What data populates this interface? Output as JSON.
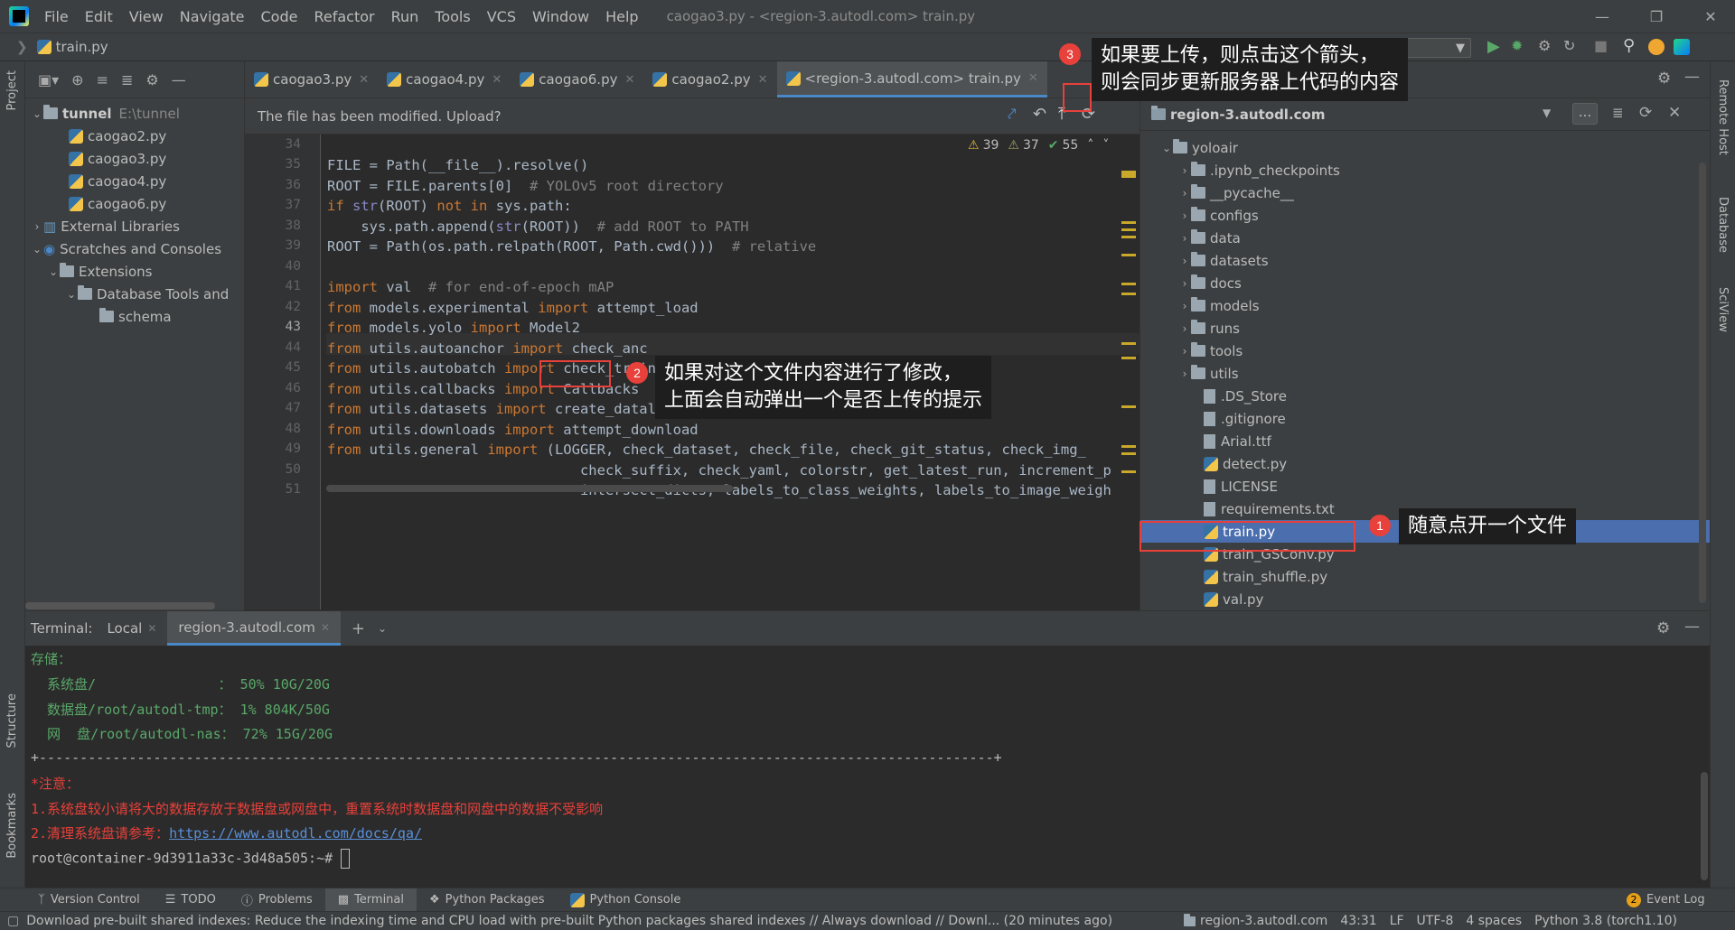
{
  "window": {
    "title": "caogao3.py - <region-3.autodl.com> train.py"
  },
  "menu": [
    "File",
    "Edit",
    "View",
    "Navigate",
    "Code",
    "Refactor",
    "Run",
    "Tools",
    "VCS",
    "Window",
    "Help"
  ],
  "nav": {
    "breadcrumb": "train.py"
  },
  "left_strip": {
    "project": "Project",
    "structure": "Structure",
    "bookmarks": "Bookmarks"
  },
  "right_strip": {
    "remote_host": "Remote Host",
    "database": "Database",
    "sciview": "SciView"
  },
  "project": {
    "root": {
      "name": "tunnel",
      "path": "E:\\tunnel"
    },
    "files": [
      "caogao2.py",
      "caogao3.py",
      "caogao4.py",
      "caogao6.py"
    ],
    "external": "External Libraries",
    "scratches": "Scratches and Consoles",
    "extensions": "Extensions",
    "dbtools": "Database Tools and",
    "schema": "schema"
  },
  "tabs": [
    {
      "label": "caogao3.py",
      "active": false
    },
    {
      "label": "caogao4.py",
      "active": false
    },
    {
      "label": "caogao6.py",
      "active": false
    },
    {
      "label": "caogao2.py",
      "active": false
    },
    {
      "label": "<region-3.autodl.com> train.py",
      "active": true
    }
  ],
  "notice": {
    "text": "The file has been modified. Upload?"
  },
  "inspections": {
    "warn1": "39",
    "warn2": "37",
    "ok": "55"
  },
  "code": {
    "line_numbers": [
      "34",
      "35",
      "36",
      "37",
      "38",
      "39",
      "40",
      "41",
      "42",
      "43",
      "44",
      "45",
      "46",
      "47",
      "48",
      "49",
      "50",
      "51"
    ],
    "l35": [
      "FILE = Path(__file__).resolve()"
    ],
    "l36a": "ROOT = FILE.parents[0]",
    "l36c": "# YOLOv5 root directory",
    "l37a": "if",
    "l37b": "str",
    "l37c": "(ROOT)",
    "l37d": "not in",
    "l37e": "sys.path:",
    "l38a": "    sys.path.append(",
    "l38b": "str",
    "l38c": "(ROOT))",
    "l38d": "# add ROOT to PATH",
    "l39a": "ROOT = Path(os.path.relpath(ROOT, Path.cwd()))",
    "l39c": "# relative",
    "l41a": "import",
    "l41b": " val",
    "l41c": "# for end-of-epoch mAP",
    "l42a": "from",
    "l42b": " models.experimental ",
    "l42c": "import",
    "l42d": " attempt_load",
    "l43a": "from",
    "l43b": " models.yolo ",
    "l43c": "import",
    "l43d": "Model2",
    "l44a": "from",
    "l44b": " utils.autoanchor ",
    "l44c": "import",
    "l44d": " check_anc",
    "l45a": "from",
    "l45b": " utils.autobatch ",
    "l45c": "import",
    "l45d": " check_train_batch_size",
    "l46a": "from",
    "l46b": " utils.callbacks ",
    "l46c": "import",
    "l46d": " Callbacks",
    "l47a": "from",
    "l47b": " utils.datasets ",
    "l47c": "import",
    "l47d": " create_dataloader",
    "l48a": "from",
    "l48b": " utils.downloads ",
    "l48c": "import",
    "l48d": " attempt_download",
    "l49a": "from",
    "l49b": " utils.general ",
    "l49c": "import",
    "l49d": " (LOGGER, check_dataset, check_file, check_git_status, check_img_",
    "l50": "                              check_suffix, check_yaml, colorstr, get_latest_run, increment_p",
    "l51": "                              intersect_dicts, labels_to_class_weights, labels_to_image_weigh"
  },
  "remote": {
    "host": "region-3.autodl.com",
    "root": "yoloair",
    "folders": [
      ".ipynb_checkpoints",
      "__pycache__",
      "configs",
      "data",
      "datasets",
      "docs",
      "models",
      "runs",
      "tools",
      "utils"
    ],
    "files": [
      ".DS_Store",
      ".gitignore",
      "Arial.ttf",
      "detect.py",
      "LICENSE",
      "requirements.txt",
      "train.py",
      "train_GSConv.py",
      "train_shuffle.py",
      "val.py"
    ],
    "selected": "train.py"
  },
  "terminal": {
    "label": "Terminal:",
    "tabs": [
      "Local",
      "region-3.autodl.com"
    ],
    "lines": {
      "storage": "存储：",
      "sys": "  系统盘/               ： 50% 10G/20G",
      "data": "  数据盘/root/autodl-tmp： 1% 804K/50G",
      "net": "  网  盘/root/autodl-nas： 72% 15G/20G",
      "sep": "+---------------------------------------------------------------------------------------------------------------------+",
      "note": "*注意：",
      "n1": "1.系统盘较小请将大的数据存放于数据盘或网盘中，重置系统时数据盘和网盘中的数据不受影响",
      "n2a": "2.清理系统盘请参考：",
      "n2b": "https://www.autodl.com/docs/qa/",
      "prompt": "root@container-9d3911a33c-3d48a505:~# "
    }
  },
  "bottom_tabs": [
    "Version Control",
    "TODO",
    "Problems",
    "Terminal",
    "Python Packages",
    "Python Console"
  ],
  "event_log": {
    "count": "2",
    "label": "Event Log"
  },
  "status": {
    "message": "Download pre-built shared indexes: Reduce the indexing time and CPU load with pre-built Python packages shared indexes // Always download // Downl... (20 minutes ago)",
    "host": "region-3.autodl.com",
    "pos": "43:31",
    "eol": "LF",
    "enc": "UTF-8",
    "indent": "4 spaces",
    "interp": "Python 3.8 (torch1.10)"
  },
  "annotations": {
    "a1": {
      "num": "1",
      "text": "随意点开一个文件"
    },
    "a2": {
      "num": "2",
      "line1": "如果对这个文件内容进行了修改，",
      "line2": "上面会自动弹出一个是否上传的提示"
    },
    "a3": {
      "num": "3",
      "line1": "如果要上传，则点击这个箭头，",
      "line2": "则会同步更新服务器上代码的内容"
    }
  },
  "colors": {
    "accent": "#4a88c7",
    "selection": "#4b6eaf",
    "callout_red": "#e8403a"
  }
}
